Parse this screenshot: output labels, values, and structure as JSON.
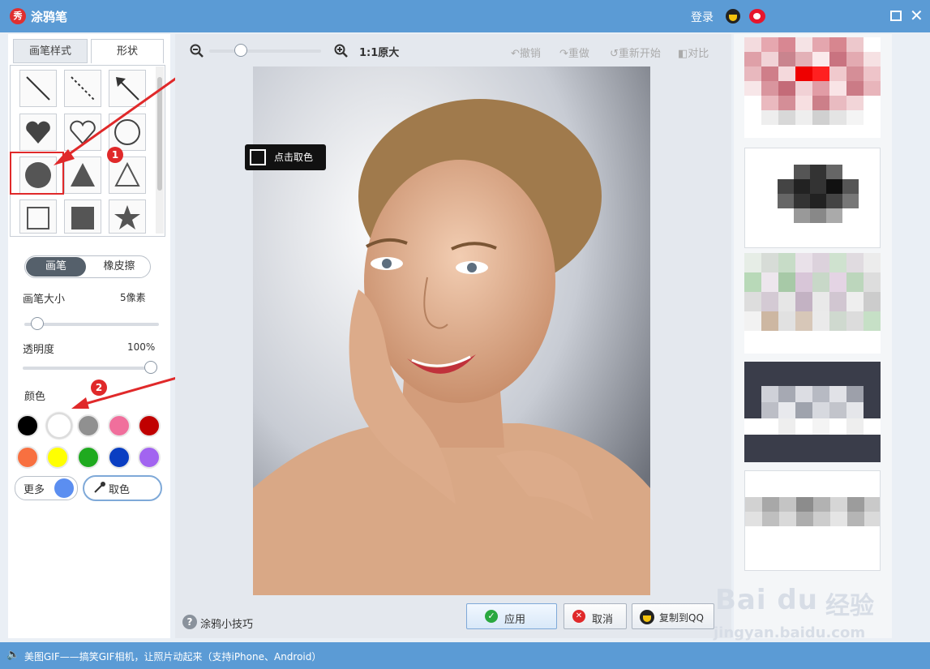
{
  "window": {
    "title": "涂鸦笔",
    "app_icon": "秀",
    "login_label": "登录",
    "icons": [
      "qq-icon",
      "weibo-icon",
      "maximize-icon",
      "close-icon"
    ]
  },
  "left_panel": {
    "tabs": [
      {
        "label": "画笔样式",
        "active": false
      },
      {
        "label": "形状",
        "active": true
      }
    ],
    "shapes": [
      "line",
      "dashed-line",
      "arrow",
      "heart-filled",
      "heart-outline",
      "circle-outline",
      "circle-filled",
      "triangle-filled",
      "triangle-outline",
      "square-outline",
      "square-filled",
      "star-filled"
    ],
    "mode": {
      "brush": "画笔",
      "eraser": "橡皮擦",
      "active": "画笔"
    },
    "brush_size": {
      "label": "画笔大小",
      "value": "5像素",
      "fraction": 0.05
    },
    "opacity": {
      "label": "透明度",
      "value": "100%",
      "fraction": 1.0
    },
    "color_label": "颜色",
    "colors": [
      "#000000",
      "#ffffff",
      "#909090",
      "#f06f9c",
      "#c00000",
      "#f87040",
      "#ffff00",
      "#1faa1f",
      "#0a3ec2",
      "#a264f0"
    ],
    "more_label": "更多",
    "current_color": "#5b8ef0",
    "pick_label": "取色",
    "annotations": {
      "badge1": "1",
      "badge2": "2"
    }
  },
  "toolbar": {
    "zoom_label": "1:1原大",
    "zoom_fraction": 0.25,
    "undo": "撤销",
    "redo": "重做",
    "restart": "重新开始",
    "compare": "对比"
  },
  "canvas": {
    "tooltip": "点击取色"
  },
  "bottom": {
    "tips": "涂鸦小技巧",
    "apply": "应用",
    "cancel": "取消",
    "copy_qq": "复制到QQ"
  },
  "status_bar": {
    "text": "美图GIF——搞笑GIF相机，让照片动起来（支持iPhone、Android）"
  },
  "watermark": {
    "logo": "Bai du",
    "brand": "经验",
    "url": "jingyan.baidu.com"
  },
  "colors": {
    "titlebar": "#5b9bd5",
    "highlight_red": "#e0292a"
  }
}
